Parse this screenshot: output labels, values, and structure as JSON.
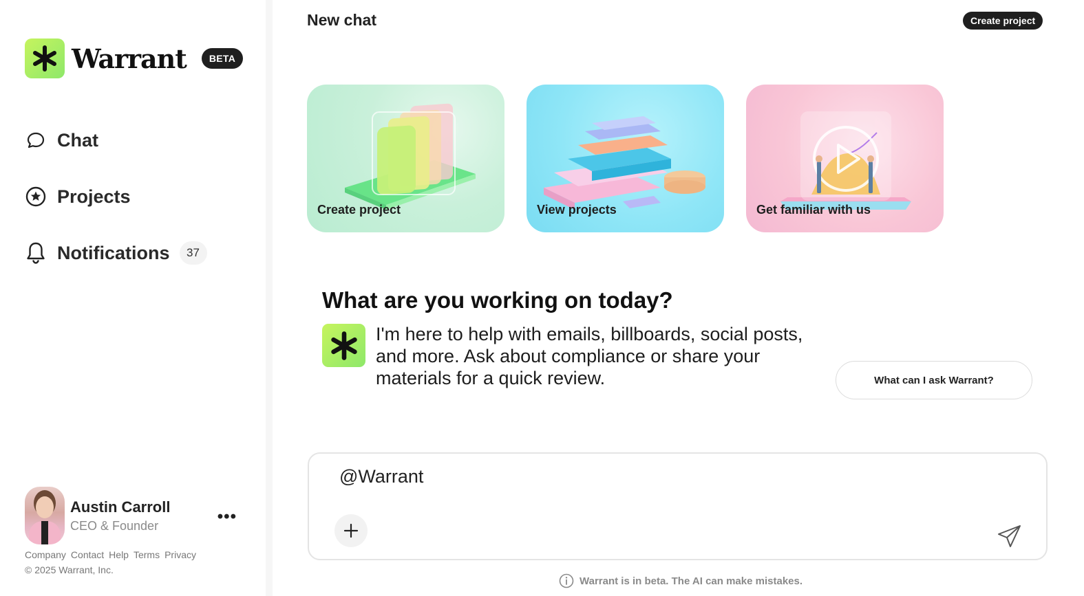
{
  "brand": {
    "name": "Warrant",
    "badge": "BETA",
    "accent": "#a9ee5f"
  },
  "sidebar": {
    "items": [
      {
        "label": "Chat",
        "icon": "chat-bubble-icon"
      },
      {
        "label": "Projects",
        "icon": "star-circle-icon"
      },
      {
        "label": "Notifications",
        "icon": "bell-icon",
        "count": "37"
      }
    ]
  },
  "user": {
    "name": "Austin Carroll",
    "role": "CEO & Founder",
    "more": "•••"
  },
  "footer": {
    "links": [
      "Company",
      "Contact",
      "Help",
      "Terms",
      "Privacy"
    ],
    "copyright": "© 2025 Warrant, Inc."
  },
  "header": {
    "title": "New chat",
    "create_project": "Create project"
  },
  "cards": [
    {
      "label": "Create project"
    },
    {
      "label": "View projects"
    },
    {
      "label": "Get familiar with us"
    }
  ],
  "main": {
    "heading": "What are you working on today?",
    "assistant_message": "I'm here to help with emails, billboards, social posts, and more. Ask about compliance or share your materials for a quick review.",
    "ask_button": "What can I ask Warrant?"
  },
  "composer": {
    "value": "@Warrant"
  },
  "disclaimer": "Warrant is in beta. The AI can make mistakes."
}
